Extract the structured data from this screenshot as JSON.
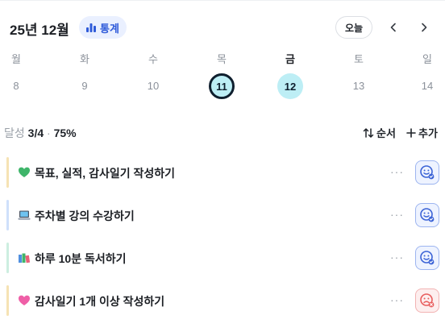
{
  "header": {
    "month_title": "25년 12월",
    "stats_label": "통계",
    "today_label": "오늘"
  },
  "week": {
    "days": [
      {
        "name": "월",
        "date": "8"
      },
      {
        "name": "화",
        "date": "9"
      },
      {
        "name": "수",
        "date": "10"
      },
      {
        "name": "목",
        "date": "11"
      },
      {
        "name": "금",
        "date": "12"
      },
      {
        "name": "토",
        "date": "13"
      },
      {
        "name": "일",
        "date": "14"
      }
    ]
  },
  "summary": {
    "progress_label": "달성",
    "progress_count": "3/4",
    "progress_sep": "·",
    "progress_percent": "75%",
    "order_label": "순서",
    "add_label": "추가"
  },
  "goals": [
    {
      "label": "목표, 실적, 감사일기 작성하기",
      "more": "···",
      "icon": "green-heart",
      "status": "happy"
    },
    {
      "label": "주차별 강의 수강하기",
      "more": "···",
      "icon": "laptop",
      "status": "happy"
    },
    {
      "label": "하루 10분 독서하기",
      "more": "···",
      "icon": "books",
      "status": "happy"
    },
    {
      "label": "감사일기 1개 이상 작성하기",
      "more": "···",
      "icon": "pink-heart",
      "status": "sad"
    }
  ],
  "colors": {
    "accent": "#2f5bd9",
    "today_ring": "#0f1f2e",
    "selected_fill": "#bdeef5",
    "fail_red": "#e85d5d"
  }
}
